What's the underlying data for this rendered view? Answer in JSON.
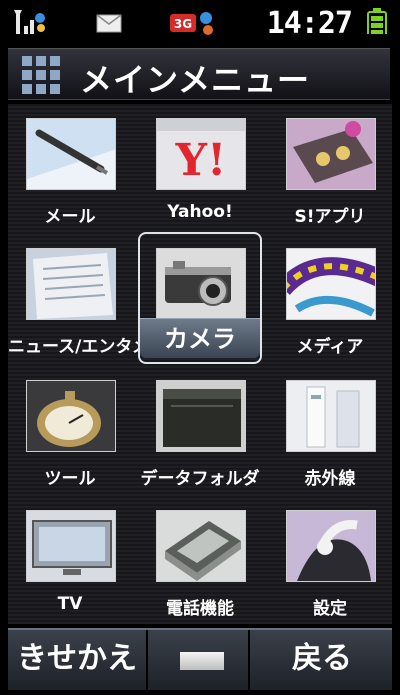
{
  "status_bar": {
    "time": "14:27",
    "network_badge": "3G",
    "icons": [
      "signal-icon",
      "mail-icon",
      "3g-icon",
      "battery-icon"
    ]
  },
  "header": {
    "title": "メインメニュー"
  },
  "menu": {
    "items": [
      {
        "label": "メール",
        "icon": "mail-pen-icon"
      },
      {
        "label": "Yahoo!",
        "icon": "yahoo-icon"
      },
      {
        "label": "S!アプリ",
        "icon": "app-icon"
      },
      {
        "label": "ニュース/エンタメ",
        "icon": "news-icon"
      },
      {
        "label": "カメラ",
        "icon": "camera-icon"
      },
      {
        "label": "メディア",
        "icon": "media-icon"
      },
      {
        "label": "ツール",
        "icon": "stopwatch-icon"
      },
      {
        "label": "データフォルダ",
        "icon": "folder-icon"
      },
      {
        "label": "赤外線",
        "icon": "infrared-icon"
      },
      {
        "label": "TV",
        "icon": "tv-icon"
      },
      {
        "label": "電話機能",
        "icon": "phone-icon"
      },
      {
        "label": "設定",
        "icon": "settings-icon"
      }
    ],
    "selected": "カメラ"
  },
  "softkeys": {
    "left": "きせかえ",
    "right": "戻る"
  },
  "colors": {
    "background": "#000000",
    "selection": "#dfe4ea",
    "softkey_bar": "#2c313a",
    "yahoo_red": "#e3262e",
    "battery": "#7ed321"
  }
}
